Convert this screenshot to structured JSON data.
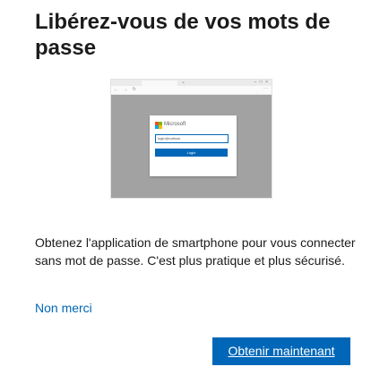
{
  "dialog": {
    "title": "Libérez-vous de vos mots de passe",
    "description": "Obtenez l'application de smartphone pour vous connecter sans mot de passe. C'est plus pratique et plus sécurisé.",
    "decline_link": "Non merci",
    "primary_button": "Obtenir maintenant"
  },
  "illustration": {
    "tab_close": "×",
    "window_controls": "– □ ×",
    "nav_icons": "← → ↻",
    "nav_more": "···",
    "brand_name": "Microsoft",
    "login_field_value": "login@outlook",
    "login_button_label": "Login",
    "brand_colors": [
      "#f25022",
      "#7fba00",
      "#00a4ef",
      "#ffb900"
    ]
  },
  "colors": {
    "accent": "#0067b8",
    "text": "#1b1b1b",
    "viewport_gray": "#a2a2a2"
  }
}
